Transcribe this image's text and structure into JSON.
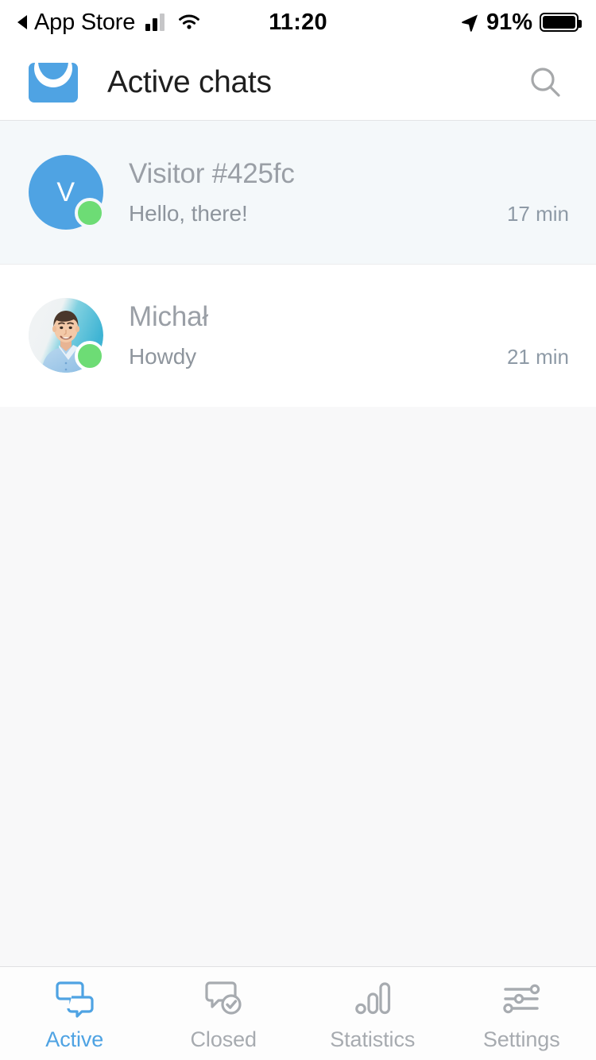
{
  "status_bar": {
    "back_label": "App Store",
    "back_icon": "triangle-left-icon",
    "signal_icon": "cellular-signal-icon",
    "wifi_icon": "wifi-icon",
    "time": "11:20",
    "location_icon": "location-arrow-icon",
    "battery_percent": "91%",
    "battery_icon": "battery-full-icon"
  },
  "header": {
    "logo_icon": "livechat-logo-icon",
    "title": "Active chats",
    "search_icon": "search-icon"
  },
  "chats": [
    {
      "name": "Visitor #425fc",
      "preview": "Hello, there!",
      "time": "17 min",
      "avatar_type": "initial",
      "avatar_initial": "V",
      "avatar_color": "#4fa3e3",
      "status": "online",
      "state": "unread"
    },
    {
      "name": "Michał",
      "preview": "Howdy",
      "time": "21 min",
      "avatar_type": "photo",
      "avatar_initial": "",
      "avatar_color": "#5cc0d8",
      "status": "online",
      "state": "read"
    }
  ],
  "tabs": [
    {
      "label": "Active",
      "icon": "chat-bubbles-icon",
      "active": true
    },
    {
      "label": "Closed",
      "icon": "chat-check-icon",
      "active": false
    },
    {
      "label": "Statistics",
      "icon": "bar-chart-icon",
      "active": false
    },
    {
      "label": "Settings",
      "icon": "sliders-icon",
      "active": false
    }
  ],
  "colors": {
    "accent": "#4fa3e3",
    "online": "#6ddc75",
    "text_primary": "#1f1f1f",
    "text_muted": "#9a9fa6",
    "tab_inactive": "#a7abb0",
    "row_unread_bg": "#f4f8fa",
    "page_bg": "#f8f8f9"
  }
}
